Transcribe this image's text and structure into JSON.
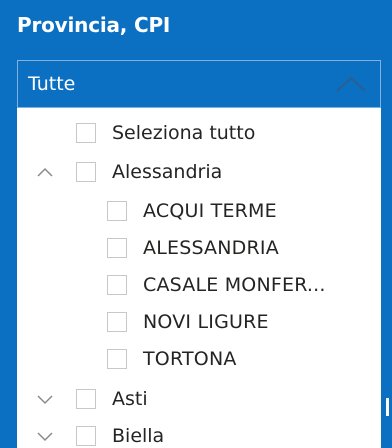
{
  "title": "Provincia, CPI",
  "dropdown": {
    "value": "Tutte"
  },
  "items": [
    {
      "label": "Seleziona tutto",
      "level": 0,
      "expander": "none",
      "checked": false
    },
    {
      "label": "Alessandria",
      "level": 0,
      "expander": "expanded",
      "checked": false
    },
    {
      "label": "ACQUI TERME",
      "level": 1,
      "expander": "none",
      "checked": false
    },
    {
      "label": "ALESSANDRIA",
      "level": 1,
      "expander": "none",
      "checked": false
    },
    {
      "label": "CASALE MONFER...",
      "level": 1,
      "expander": "none",
      "checked": false
    },
    {
      "label": "NOVI LIGURE",
      "level": 1,
      "expander": "none",
      "checked": false
    },
    {
      "label": "TORTONA",
      "level": 1,
      "expander": "none",
      "checked": false
    },
    {
      "label": "Asti",
      "level": 0,
      "expander": "collapsed",
      "checked": false
    },
    {
      "label": "Biella",
      "level": 0,
      "expander": "collapsed",
      "checked": false
    }
  ],
  "colors": {
    "header_bg": "#0b6fc2",
    "text": "#252423",
    "chevron": "#8a8a8a"
  }
}
